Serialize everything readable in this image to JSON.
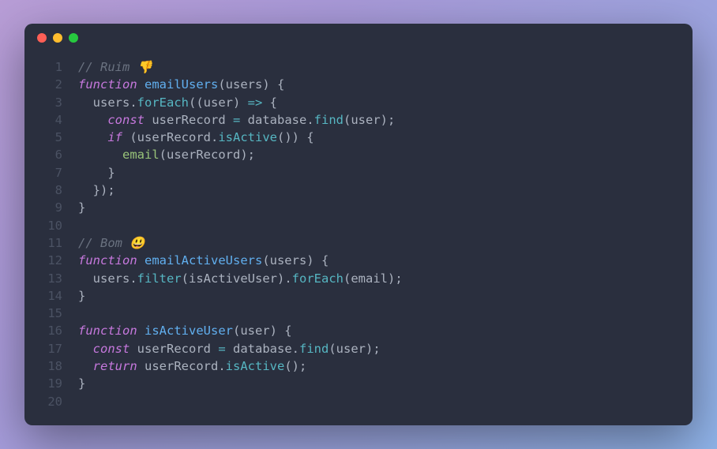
{
  "window": {
    "traffic_lights": [
      "red",
      "yellow",
      "green"
    ]
  },
  "code": {
    "line_numbers": [
      "1",
      "2",
      "3",
      "4",
      "5",
      "6",
      "7",
      "8",
      "9",
      "10",
      "11",
      "12",
      "13",
      "14",
      "15",
      "16",
      "17",
      "18",
      "19",
      "20"
    ],
    "lines": [
      [
        {
          "t": "// Ruim 👎",
          "c": "comment"
        }
      ],
      [
        {
          "t": "function",
          "c": "keyword"
        },
        {
          "t": " ",
          "c": "punct"
        },
        {
          "t": "emailUsers",
          "c": "func-name"
        },
        {
          "t": "(users) {",
          "c": "punct"
        }
      ],
      [
        {
          "t": "  users",
          "c": "variable"
        },
        {
          "t": ".",
          "c": "punct"
        },
        {
          "t": "forEach",
          "c": "method"
        },
        {
          "t": "((",
          "c": "punct"
        },
        {
          "t": "user",
          "c": "param"
        },
        {
          "t": ") ",
          "c": "punct"
        },
        {
          "t": "=>",
          "c": "operator"
        },
        {
          "t": " {",
          "c": "punct"
        }
      ],
      [
        {
          "t": "    ",
          "c": "punct"
        },
        {
          "t": "const",
          "c": "const-kw"
        },
        {
          "t": " userRecord ",
          "c": "variable"
        },
        {
          "t": "=",
          "c": "operator"
        },
        {
          "t": " database",
          "c": "variable"
        },
        {
          "t": ".",
          "c": "punct"
        },
        {
          "t": "find",
          "c": "method"
        },
        {
          "t": "(user);",
          "c": "punct"
        }
      ],
      [
        {
          "t": "    ",
          "c": "punct"
        },
        {
          "t": "if",
          "c": "keyword"
        },
        {
          "t": " (userRecord",
          "c": "variable"
        },
        {
          "t": ".",
          "c": "punct"
        },
        {
          "t": "isActive",
          "c": "method"
        },
        {
          "t": "()) {",
          "c": "punct"
        }
      ],
      [
        {
          "t": "      ",
          "c": "punct"
        },
        {
          "t": "email",
          "c": "call-color"
        },
        {
          "t": "(userRecord);",
          "c": "punct"
        }
      ],
      [
        {
          "t": "    }",
          "c": "punct"
        }
      ],
      [
        {
          "t": "  });",
          "c": "punct"
        }
      ],
      [
        {
          "t": "}",
          "c": "punct"
        }
      ],
      [
        {
          "t": "",
          "c": "punct"
        }
      ],
      [
        {
          "t": "// Bom 😃",
          "c": "comment"
        }
      ],
      [
        {
          "t": "function",
          "c": "keyword"
        },
        {
          "t": " ",
          "c": "punct"
        },
        {
          "t": "emailActiveUsers",
          "c": "func-name"
        },
        {
          "t": "(users) {",
          "c": "punct"
        }
      ],
      [
        {
          "t": "  users",
          "c": "variable"
        },
        {
          "t": ".",
          "c": "punct"
        },
        {
          "t": "filter",
          "c": "method"
        },
        {
          "t": "(isActiveUser)",
          "c": "punct"
        },
        {
          "t": ".",
          "c": "punct"
        },
        {
          "t": "forEach",
          "c": "method"
        },
        {
          "t": "(email);",
          "c": "punct"
        }
      ],
      [
        {
          "t": "}",
          "c": "punct"
        }
      ],
      [
        {
          "t": "",
          "c": "punct"
        }
      ],
      [
        {
          "t": "function",
          "c": "keyword"
        },
        {
          "t": " ",
          "c": "punct"
        },
        {
          "t": "isActiveUser",
          "c": "func-name"
        },
        {
          "t": "(user) {",
          "c": "punct"
        }
      ],
      [
        {
          "t": "  ",
          "c": "punct"
        },
        {
          "t": "const",
          "c": "const-kw"
        },
        {
          "t": " userRecord ",
          "c": "variable"
        },
        {
          "t": "=",
          "c": "operator"
        },
        {
          "t": " database",
          "c": "variable"
        },
        {
          "t": ".",
          "c": "punct"
        },
        {
          "t": "find",
          "c": "method"
        },
        {
          "t": "(user);",
          "c": "punct"
        }
      ],
      [
        {
          "t": "  ",
          "c": "punct"
        },
        {
          "t": "return",
          "c": "return-kw"
        },
        {
          "t": " userRecord",
          "c": "variable"
        },
        {
          "t": ".",
          "c": "punct"
        },
        {
          "t": "isActive",
          "c": "method"
        },
        {
          "t": "();",
          "c": "punct"
        }
      ],
      [
        {
          "t": "}",
          "c": "punct"
        }
      ],
      [
        {
          "t": "",
          "c": "punct"
        }
      ]
    ]
  }
}
